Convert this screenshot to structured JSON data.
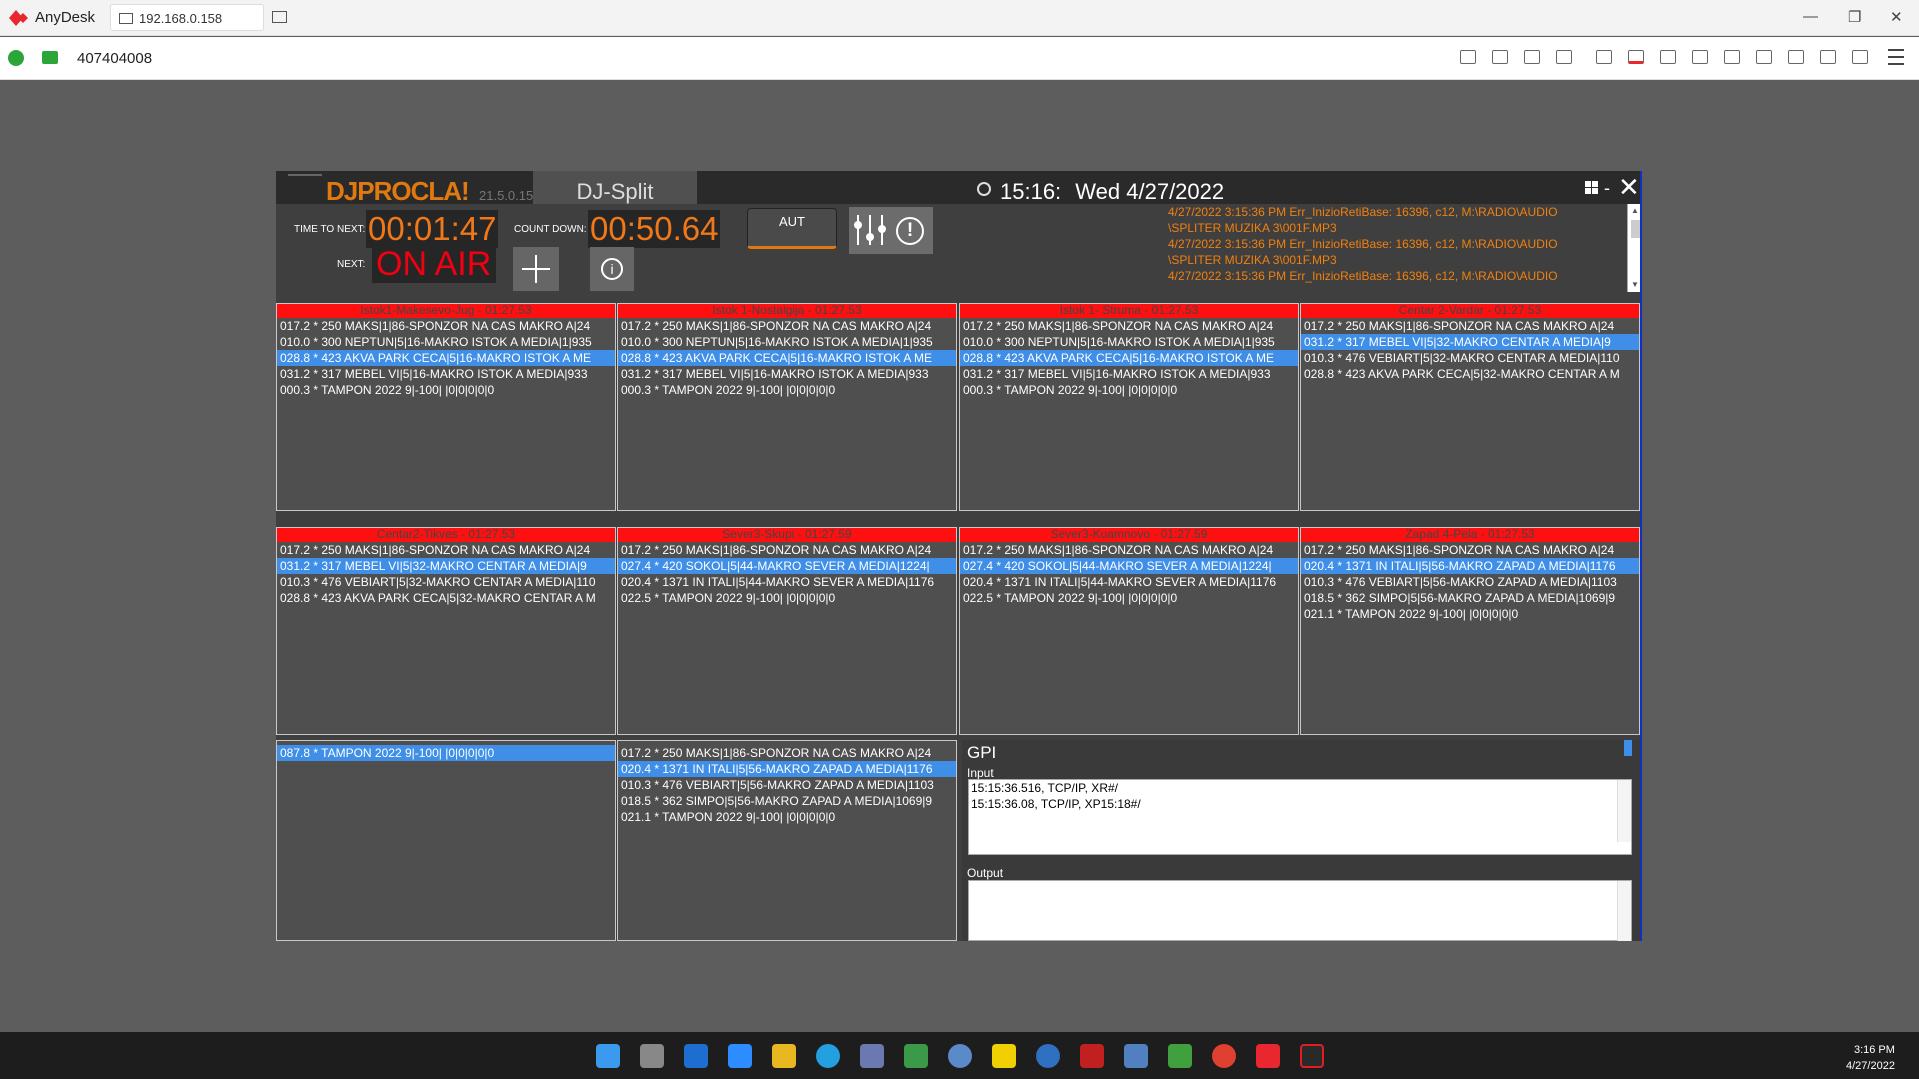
{
  "titlebar": {
    "app_name": "AnyDesk",
    "tab_label": "192.168.0.158",
    "min": "—",
    "max": "❐",
    "close": "✕"
  },
  "addressbar": {
    "id_value": "407404008"
  },
  "app": {
    "logo": "DJPROCLA!",
    "version": "21.5.0.15",
    "title": "DJ-Split",
    "clock_time": "15:16:",
    "clock_date": "Wed 4/27/2022",
    "time_to_next_label": "TIME TO NEXT:",
    "time_to_next": "00:01:47",
    "countdown_label": "COUNT DOWN:",
    "countdown": "00:50.64",
    "next_label": "NEXT:",
    "next_value": "ON AIR",
    "aut_label": "AUT",
    "info_label": "i",
    "warn_label": "!"
  },
  "log": [
    "4/27/2022 3:15:36 PM Err_InizioRetiBase: 16396, c12, M:\\RADIO\\AUDIO",
    "\\SPLITER MUZIKA 3\\001F.MP3",
    "4/27/2022 3:15:36 PM Err_InizioRetiBase: 16396, c12, M:\\RADIO\\AUDIO",
    "\\SPLITER MUZIKA 3\\001F.MP3",
    "4/27/2022 3:15:36 PM Err_InizioRetiBase: 16396, c12, M:\\RADIO\\AUDIO"
  ],
  "panels": [
    {
      "title": "Istok1-Makesevo-Jug - 01:27.53",
      "rows": [
        "017.2 * 250 MAKS|1|86-SPONZOR NA CAS MAKRO A|24",
        "010.0 * 300 NEPTUN|5|16-MAKRO ISTOK A MEDIA|1|935",
        "028.8 * 423 AKVA PARK CECA|5|16-MAKRO ISTOK A ME",
        "031.2 * 317 MEBEL VI|5|16-MAKRO ISTOK A MEDIA|933",
        "000.3 * TAMPON 2022 9|-100| |0|0|0|0|0"
      ],
      "sel": 2
    },
    {
      "title": "Istok 1-Nostalgija - 01:27.53",
      "rows": [
        "017.2 * 250 MAKS|1|86-SPONZOR NA CAS MAKRO A|24",
        "010.0 * 300 NEPTUN|5|16-MAKRO ISTOK A MEDIA|1|935",
        "028.8 * 423 AKVA PARK CECA|5|16-MAKRO ISTOK A ME",
        "031.2 * 317 MEBEL VI|5|16-MAKRO ISTOK A MEDIA|933",
        "000.3 * TAMPON 2022 9|-100| |0|0|0|0|0"
      ],
      "sel": 2
    },
    {
      "title": "Istok 1- Struma - 01:27.53",
      "rows": [
        "017.2 * 250 MAKS|1|86-SPONZOR NA CAS MAKRO A|24",
        "010.0 * 300 NEPTUN|5|16-MAKRO ISTOK A MEDIA|1|935",
        "028.8 * 423 AKVA PARK CECA|5|16-MAKRO ISTOK A ME",
        "031.2 * 317 MEBEL VI|5|16-MAKRO ISTOK A MEDIA|933",
        "000.3 * TAMPON 2022 9|-100| |0|0|0|0|0"
      ],
      "sel": 2
    },
    {
      "title": "Centar 2-Vardar - 01:27.53",
      "rows": [
        "017.2 * 250 MAKS|1|86-SPONZOR NA CAS MAKRO A|24",
        "031.2 * 317 MEBEL VI|5|32-MAKRO CENTAR A MEDIA|9",
        "010.3 * 476 VEBIART|5|32-MAKRO CENTAR A MEDIA|110",
        "028.8 * 423 AKVA PARK CECA|5|32-MAKRO CENTAR A M"
      ],
      "sel": 1
    },
    {
      "title": "Centar2-Tikves - 01:27.53",
      "rows": [
        "017.2 * 250 MAKS|1|86-SPONZOR NA CAS MAKRO A|24",
        "031.2 * 317 MEBEL VI|5|32-MAKRO CENTAR A MEDIA|9",
        "010.3 * 476 VEBIART|5|32-MAKRO CENTAR A MEDIA|110",
        "028.8 * 423 AKVA PARK CECA|5|32-MAKRO CENTAR A M"
      ],
      "sel": 1
    },
    {
      "title": "Sever3-Skupi - 01:27.59",
      "rows": [
        "017.2 * 250 MAKS|1|86-SPONZOR NA CAS MAKRO A|24",
        "027.4 * 420 SOKOL|5|44-MAKRO SEVER A MEDIA|1224|",
        "020.4 * 1371 IN ITALI|5|44-MAKRO SEVER A MEDIA|1176",
        "022.5 * TAMPON 2022 9|-100| |0|0|0|0|0"
      ],
      "sel": 1
    },
    {
      "title": "Sever3-Kuamnovo - 01:27.59",
      "rows": [
        "017.2 * 250 MAKS|1|86-SPONZOR NA CAS MAKRO A|24",
        "027.4 * 420 SOKOL|5|44-MAKRO SEVER A MEDIA|1224|",
        "020.4 * 1371 IN ITALI|5|44-MAKRO SEVER A MEDIA|1176",
        "022.5 * TAMPON 2022 9|-100| |0|0|0|0|0"
      ],
      "sel": 1
    },
    {
      "title": "Zapad 4-Pela - 01:27.53",
      "rows": [
        "017.2 * 250 MAKS|1|86-SPONZOR NA CAS MAKRO A|24",
        "020.4 * 1371 IN ITALI|5|56-MAKRO ZAPAD A MEDIA|1176",
        "010.3 * 476 VEBIART|5|56-MAKRO ZAPAD A MEDIA|1103",
        "018.5 * 362 SIMPO|5|56-MAKRO ZAPAD A MEDIA|1069|9",
        "021.1 * TAMPON 2022 9|-100| |0|0|0|0|0"
      ],
      "sel": 1
    },
    {
      "title": "",
      "rows": [
        "087.8 * TAMPON 2022 9|-100| |0|0|0|0|0"
      ],
      "sel": 0
    },
    {
      "title": "",
      "rows": [
        "017.2 * 250 MAKS|1|86-SPONZOR NA CAS MAKRO A|24",
        "020.4 * 1371 IN ITALI|5|56-MAKRO ZAPAD A MEDIA|1176",
        "010.3 * 476 VEBIART|5|56-MAKRO ZAPAD A MEDIA|1103",
        "018.5 * 362 SIMPO|5|56-MAKRO ZAPAD A MEDIA|1069|9",
        "021.1 * TAMPON 2022 9|-100| |0|0|0|0|0"
      ],
      "sel": 1
    }
  ],
  "gpi": {
    "title": "GPI",
    "input_label": "Input",
    "input_lines": [
      "15:15:36.516, TCP/IP, XR#/",
      "15:15:36.08, TCP/IP, XP15:18#/"
    ],
    "output_label": "Output"
  },
  "taskbar": {
    "time": "3:16 PM",
    "date": "4/27/2022"
  },
  "colors": {
    "accent_orange": "#f07818",
    "header_red": "#ff1010",
    "selection_blue": "#3f8fe8",
    "on_air_red": "#f00010"
  }
}
